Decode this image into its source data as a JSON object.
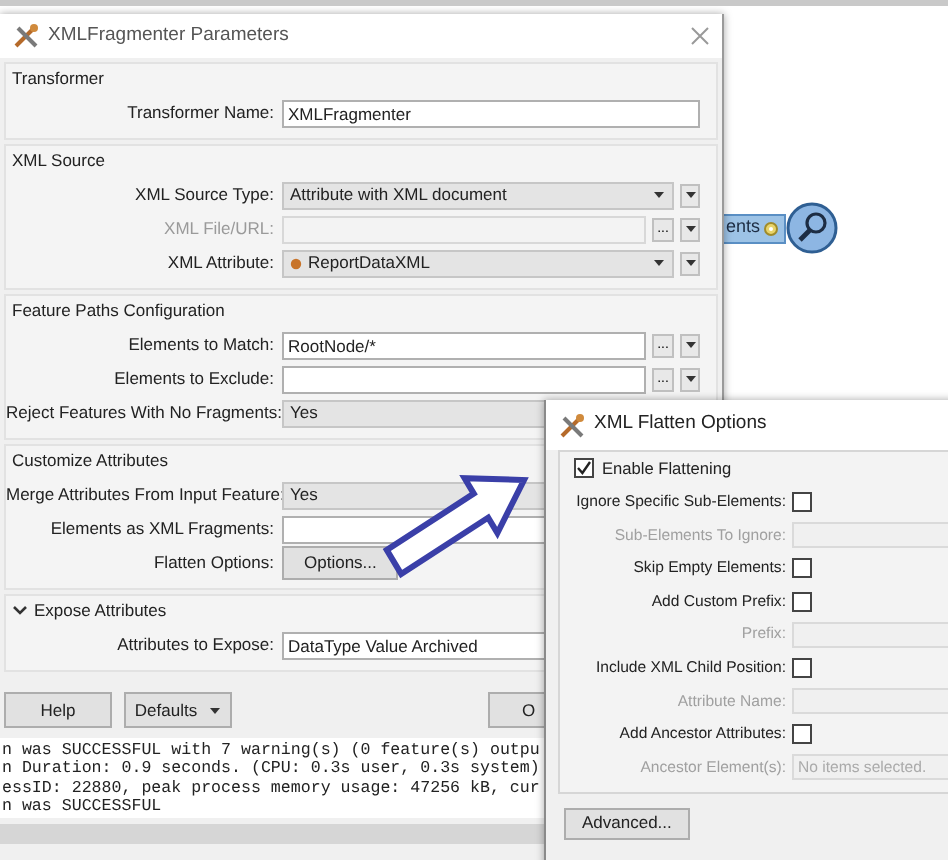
{
  "canvas_node": {
    "label": "ents"
  },
  "main_dialog": {
    "title": "XMLFragmenter Parameters",
    "sections": [
      {
        "title": "Transformer",
        "rows": [
          {
            "label": "Transformer Name:",
            "kind": "text",
            "value": "XMLFragmenter",
            "disabled": false,
            "menu": false
          }
        ]
      },
      {
        "title": "XML Source",
        "rows": [
          {
            "label": "XML Source Type:",
            "kind": "combo",
            "value": "Attribute with XML document",
            "disabled": false,
            "menu": true
          },
          {
            "label": "XML File/URL:",
            "kind": "text",
            "disabled": true,
            "browse": "...",
            "menu": true
          },
          {
            "label": "XML Attribute:",
            "kind": "attribute-combo",
            "value": "ReportDataXML",
            "disabled": false,
            "menu": true
          }
        ]
      },
      {
        "title": "Feature Paths Configuration",
        "rows": [
          {
            "label": "Elements to Match:",
            "kind": "text",
            "value": "RootNode/*",
            "disabled": false,
            "browse": "...",
            "menu": true
          },
          {
            "label": "Elements to Exclude:",
            "kind": "text",
            "disabled": false,
            "browse": "...",
            "menu": true
          },
          {
            "label": "Reject Features With No Fragments:",
            "kind": "combo",
            "value": "Yes",
            "disabled": false
          }
        ]
      },
      {
        "title": "Customize Attributes",
        "rows": [
          {
            "label": "Merge Attributes From Input Feature:",
            "kind": "combo",
            "value": "Yes",
            "disabled": false
          },
          {
            "label": "Elements as XML Fragments:",
            "kind": "text",
            "disabled": false
          },
          {
            "label": "Flatten Options:",
            "kind": "button",
            "value": "Options...",
            "disabled": false,
            "menu": false
          }
        ]
      },
      {
        "title": "Expose Attributes",
        "expanded": true,
        "rows": [
          {
            "label": "Attributes to Expose:",
            "kind": "text",
            "value": "DataType Value Archived",
            "disabled": false
          }
        ]
      }
    ],
    "buttons": [
      {
        "label": "Help",
        "kind": "plain"
      },
      {
        "label": "Defaults",
        "kind": "menu"
      },
      {
        "label": "O",
        "kind": "plain"
      }
    ],
    "log": [
      "n was SUCCESSFUL with 7 warning(s) (0 feature(s) outpu",
      "n Duration: 0.9 seconds. (CPU: 0.3s user, 0.3s system)",
      "essID: 22880, peak process memory usage: 47256 kB, cur",
      "n was SUCCESSFUL"
    ]
  },
  "flatten_dialog": {
    "title": "XML Flatten Options",
    "enable": {
      "label": "Enable Flattening",
      "checked": true
    },
    "rows": [
      {
        "label": "Ignore Specific Sub-Elements:",
        "kind": "checkbox",
        "checked": false
      },
      {
        "label": "Sub-Elements To Ignore:",
        "kind": "field",
        "disabled": true
      },
      {
        "label": "Skip Empty Elements:",
        "kind": "checkbox",
        "checked": false
      },
      {
        "label": "Add Custom Prefix:",
        "kind": "checkbox",
        "checked": false
      },
      {
        "label": "Prefix:",
        "kind": "field",
        "disabled": true
      },
      {
        "label": "Include XML Child Position:",
        "kind": "checkbox",
        "checked": false
      },
      {
        "label": "Attribute Name:",
        "kind": "field",
        "disabled": true
      },
      {
        "label": "Add Ancestor Attributes:",
        "kind": "checkbox",
        "checked": false
      },
      {
        "label": "Ancestor Element(s):",
        "kind": "field",
        "disabled": true,
        "placeholder": "No items selected."
      }
    ],
    "advanced_button": "Advanced..."
  }
}
